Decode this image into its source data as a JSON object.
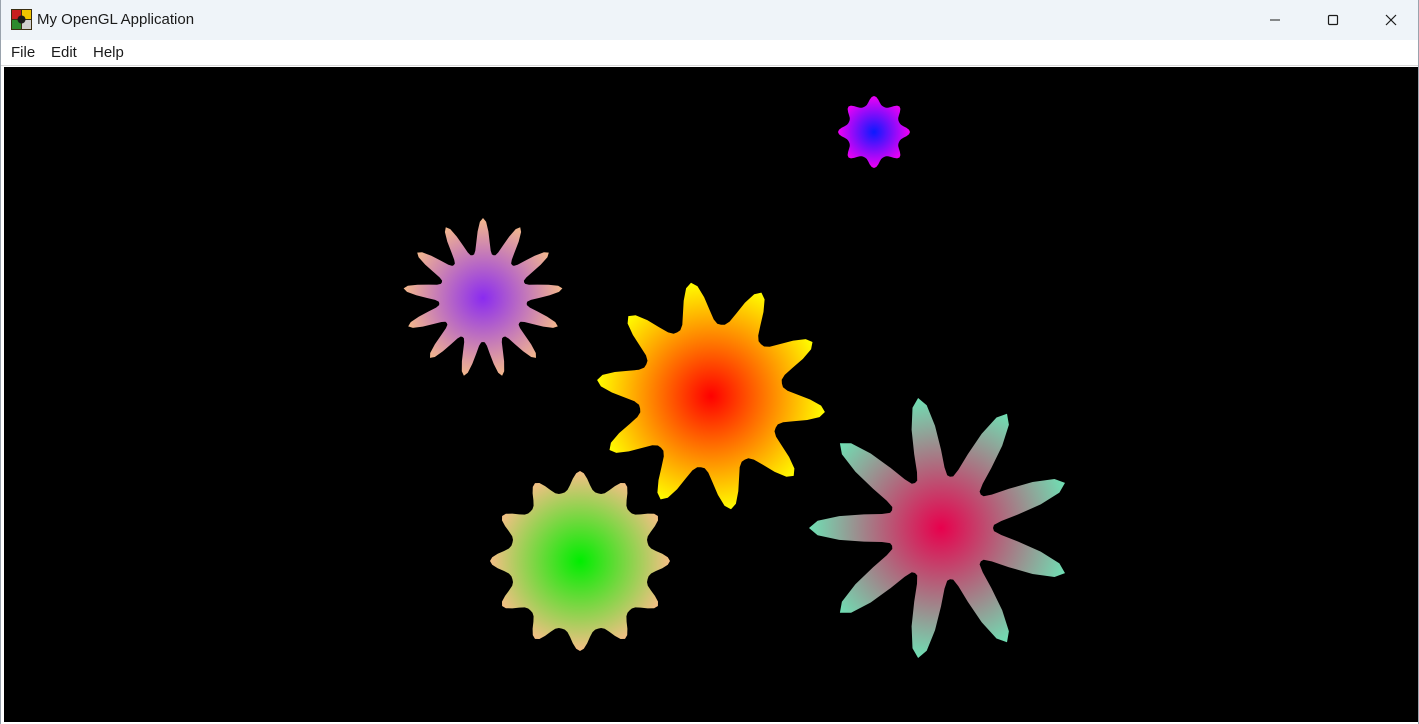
{
  "window": {
    "title": "My OpenGL Application",
    "app_icon": "opengl-app-icon",
    "controls": {
      "minimize_icon": "minimize-icon",
      "maximize_icon": "maximize-icon",
      "close_icon": "close-icon"
    }
  },
  "menu": {
    "items": [
      {
        "label": "File"
      },
      {
        "label": "Edit"
      },
      {
        "label": "Help"
      }
    ]
  },
  "scene": {
    "background": "#000000",
    "flowers": [
      {
        "name": "blue-star",
        "petals": 8,
        "center_color": "#0b1aff",
        "edge_color": "#f000f5"
      },
      {
        "name": "purple-star",
        "petals": 13,
        "center_color": "#8a2bf0",
        "edge_color": "#f4b98c"
      },
      {
        "name": "red-yellow-star",
        "petals": 10,
        "center_color": "#ff0000",
        "edge_color": "#ffff00"
      },
      {
        "name": "green-star",
        "petals": 12,
        "center_color": "#00ee00",
        "edge_color": "#f5bf86"
      },
      {
        "name": "crimson-star",
        "petals": 9,
        "center_color": "#e8004d",
        "edge_color": "#6fe0b4"
      }
    ]
  }
}
